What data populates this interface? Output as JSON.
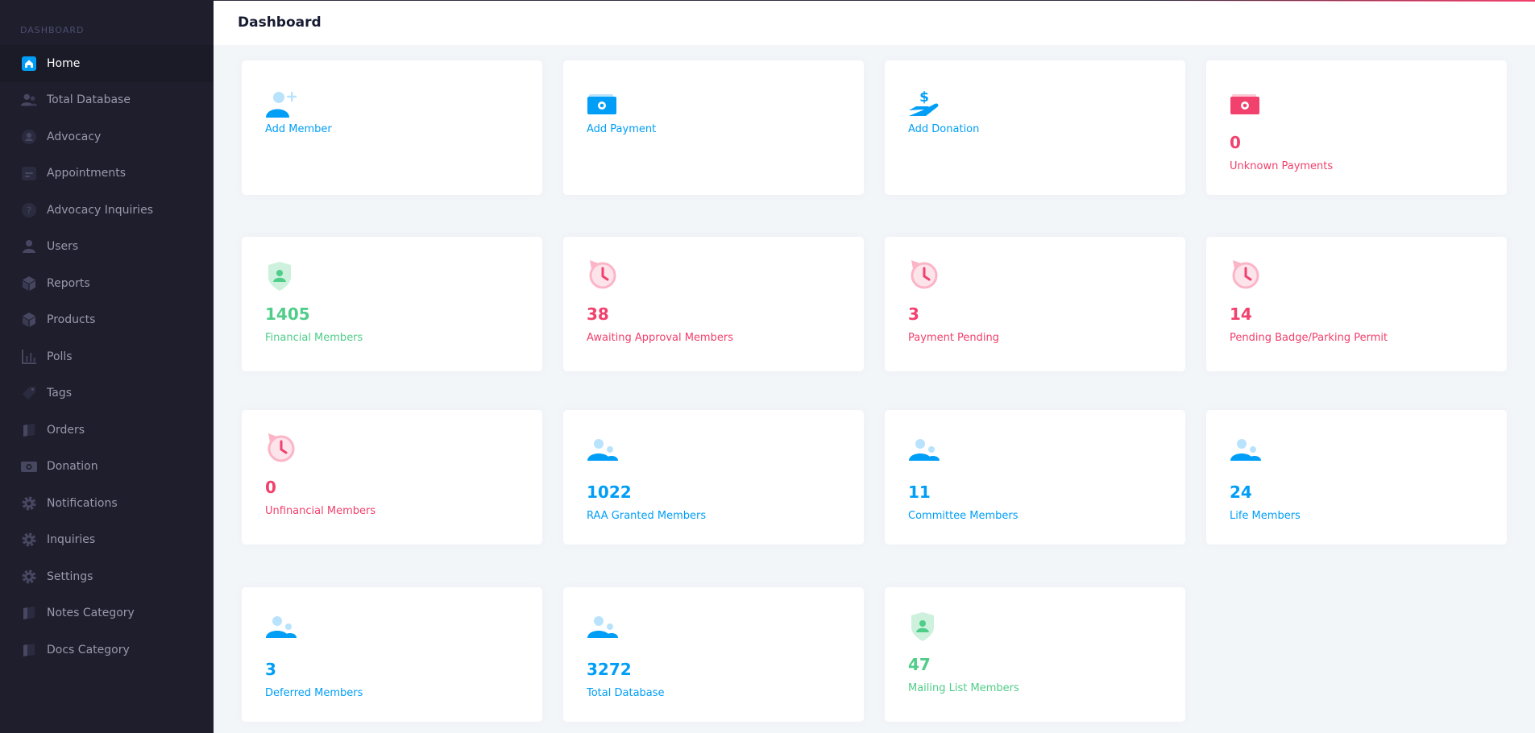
{
  "sidebar": {
    "section_title": "DASHBOARD",
    "items": [
      {
        "label": "Home",
        "icon": "home-icon"
      },
      {
        "label": "Total Database",
        "icon": "users-icon"
      },
      {
        "label": "Advocacy",
        "icon": "user-circle-icon"
      },
      {
        "label": "Appointments",
        "icon": "calendar-icon"
      },
      {
        "label": "Advocacy Inquiries",
        "icon": "question-circle-icon"
      },
      {
        "label": "Users",
        "icon": "user-icon"
      },
      {
        "label": "Reports",
        "icon": "cube-icon"
      },
      {
        "label": "Products",
        "icon": "cube-icon"
      },
      {
        "label": "Polls",
        "icon": "chart-bar-icon"
      },
      {
        "label": "Tags",
        "icon": "tag-icon"
      },
      {
        "label": "Orders",
        "icon": "box-icon"
      },
      {
        "label": "Donation",
        "icon": "money-icon"
      },
      {
        "label": "Notifications",
        "icon": "gear-icon"
      },
      {
        "label": "Inquiries",
        "icon": "gear-icon"
      },
      {
        "label": "Settings",
        "icon": "gear-icon"
      },
      {
        "label": "Notes Category",
        "icon": "box-icon"
      },
      {
        "label": "Docs Category",
        "icon": "box-icon"
      }
    ]
  },
  "header": {
    "title": "Dashboard"
  },
  "colors": {
    "primary": "#009ef7",
    "danger": "#f1416c",
    "success": "#50cd89",
    "sidebar_bg": "#1e1e2d"
  },
  "cards": [
    {
      "label": "Add Member",
      "value": "",
      "icon": "add-user-icon",
      "color": "blue"
    },
    {
      "label": "Add Payment",
      "value": "",
      "icon": "money-icon",
      "color": "blue"
    },
    {
      "label": "Add Donation",
      "value": "",
      "icon": "donation-hand-icon",
      "color": "blue"
    },
    {
      "label": "Unknown Payments",
      "value": "0",
      "icon": "money-icon",
      "color": "red"
    },
    {
      "label": "Financial Members",
      "value": "1405",
      "icon": "shield-user-icon",
      "color": "green"
    },
    {
      "label": "Awaiting Approval Members",
      "value": "38",
      "icon": "history-clock-icon",
      "color": "red"
    },
    {
      "label": "Payment Pending",
      "value": "3",
      "icon": "history-clock-icon",
      "color": "red"
    },
    {
      "label": "Pending Badge/Parking Permit",
      "value": "14",
      "icon": "history-clock-icon",
      "color": "red"
    },
    {
      "label": "Unfinancial Members",
      "value": "0",
      "icon": "history-clock-icon",
      "color": "red"
    },
    {
      "label": "RAA Granted Members",
      "value": "1022",
      "icon": "users-icon",
      "color": "blue"
    },
    {
      "label": "Committee Members",
      "value": "11",
      "icon": "users-icon",
      "color": "blue"
    },
    {
      "label": "Life Members",
      "value": "24",
      "icon": "users-icon",
      "color": "blue"
    },
    {
      "label": "Deferred Members",
      "value": "3",
      "icon": "users-icon",
      "color": "blue"
    },
    {
      "label": "Total Database",
      "value": "3272",
      "icon": "users-icon",
      "color": "blue"
    },
    {
      "label": "Mailing List Members",
      "value": "47",
      "icon": "shield-user-icon",
      "color": "green"
    }
  ]
}
